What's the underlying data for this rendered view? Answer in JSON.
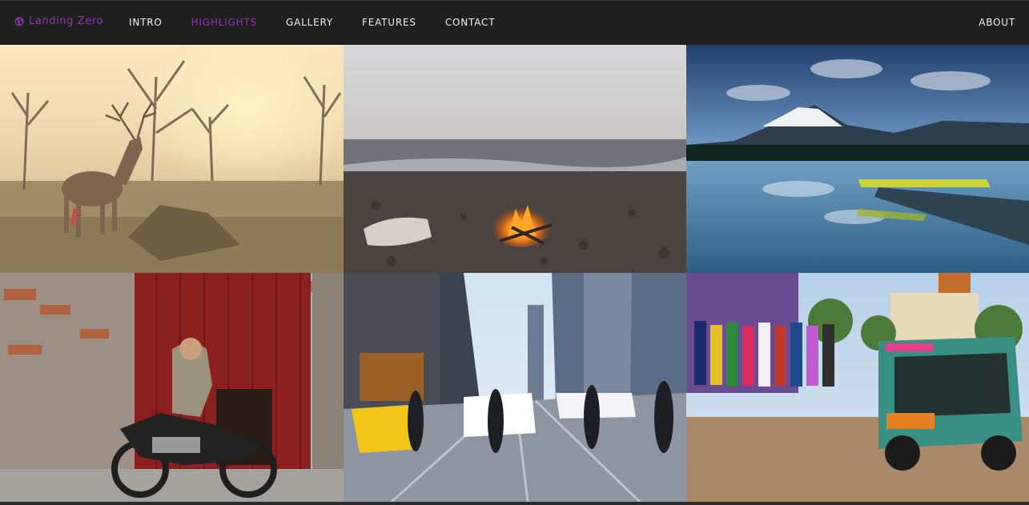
{
  "navbar": {
    "brand_label": "Landing Zero",
    "brand_icon": "globe-icon",
    "links": [
      {
        "label": "INTRO",
        "active": false
      },
      {
        "label": "HIGHLIGHTS",
        "active": true
      },
      {
        "label": "GALLERY",
        "active": false
      },
      {
        "label": "FEATURES",
        "active": false
      },
      {
        "label": "CONTACT",
        "active": false
      }
    ],
    "right_link": "ABOUT"
  },
  "colors": {
    "accent": "#8e35b3",
    "nav_bg": "#1f1f1f",
    "nav_text": "#f1f1f1"
  },
  "gallery": {
    "tiles": [
      {
        "subject": "deer-in-forest"
      },
      {
        "subject": "campfire-on-beach"
      },
      {
        "subject": "mountain-lake-dock"
      },
      {
        "subject": "street-art-motorcycle"
      },
      {
        "subject": "city-street-crosswalk"
      },
      {
        "subject": "market-tuk-tuk"
      }
    ]
  }
}
